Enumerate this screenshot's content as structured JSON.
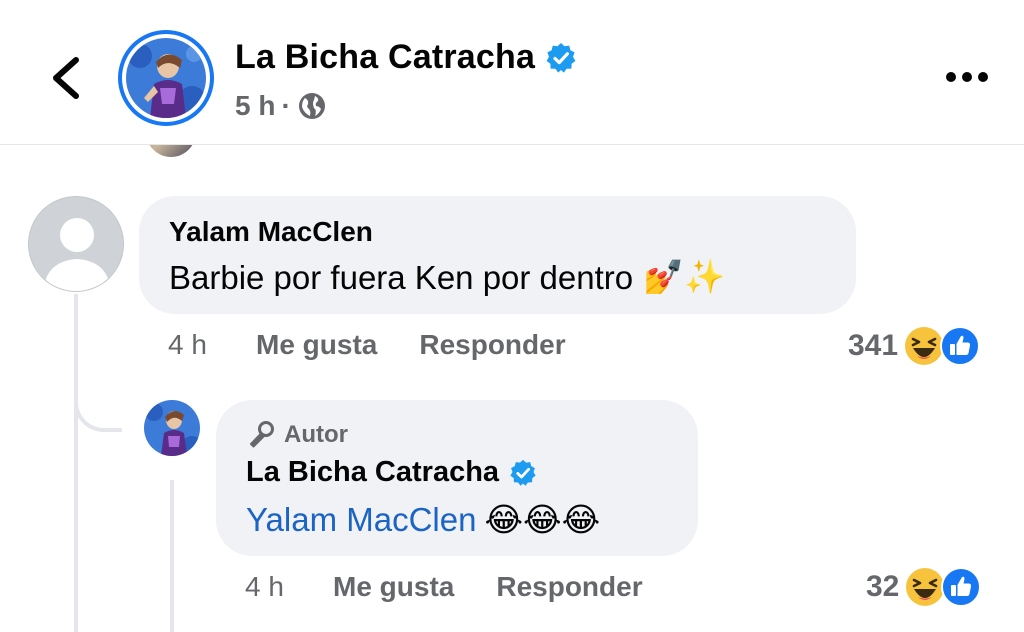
{
  "header": {
    "page_name": "La Bicha Catracha",
    "time": "5 h",
    "separator": "·",
    "audience_icon": "globe-icon",
    "more_icon": "more-dots-icon",
    "back_icon": "chevron-left-icon"
  },
  "comment": {
    "author": "Yalam MacClen",
    "text": "Barbie por fuera Ken por dentro",
    "emojis": "💅✨",
    "time": "4 h",
    "like_label": "Me gusta",
    "reply_label": "Responder",
    "reaction_count": "341"
  },
  "reply": {
    "badge_label": "Autor",
    "author": "La Bicha Catracha",
    "mention": "Yalam MacClen",
    "emojis": "😂😂😂",
    "time": "4 h",
    "like_label": "Me gusta",
    "reply_label": "Responder",
    "reaction_count": "32"
  },
  "colors": {
    "brand_blue": "#1877f2",
    "verified_blue": "#1d9bf0",
    "secondary_text": "#65676b",
    "bubble_bg": "#f0f2f5",
    "mention_blue": "#1b63c4"
  }
}
